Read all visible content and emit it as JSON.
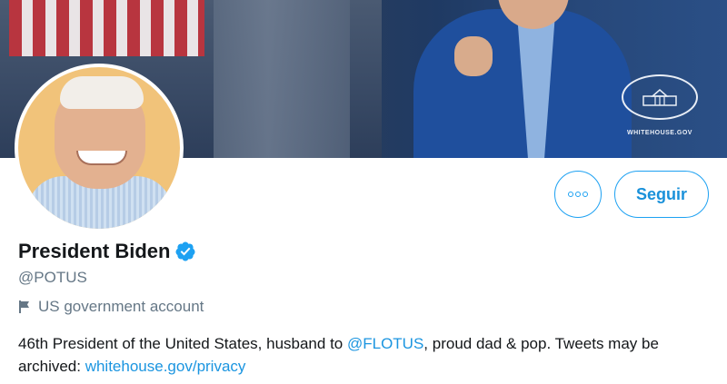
{
  "banner": {
    "logo_caption": "WHITEHOUSE.GOV"
  },
  "actions": {
    "more_icon": "ellipsis-icon",
    "follow_label": "Seguir"
  },
  "profile": {
    "name": "President Biden",
    "verified_icon": "verified-badge-icon",
    "handle": "@POTUS",
    "label_icon": "flag-icon",
    "label": "US government account",
    "bio": {
      "text1": "46th President of the United States, husband to ",
      "mention": "@FLOTUS",
      "text2": ", proud dad & pop. Tweets may be archived: ",
      "link": "whitehouse.gov/privacy"
    }
  },
  "colors": {
    "accent": "#1da1f2",
    "secondary_text": "#657786",
    "link": "#1b95e0"
  }
}
